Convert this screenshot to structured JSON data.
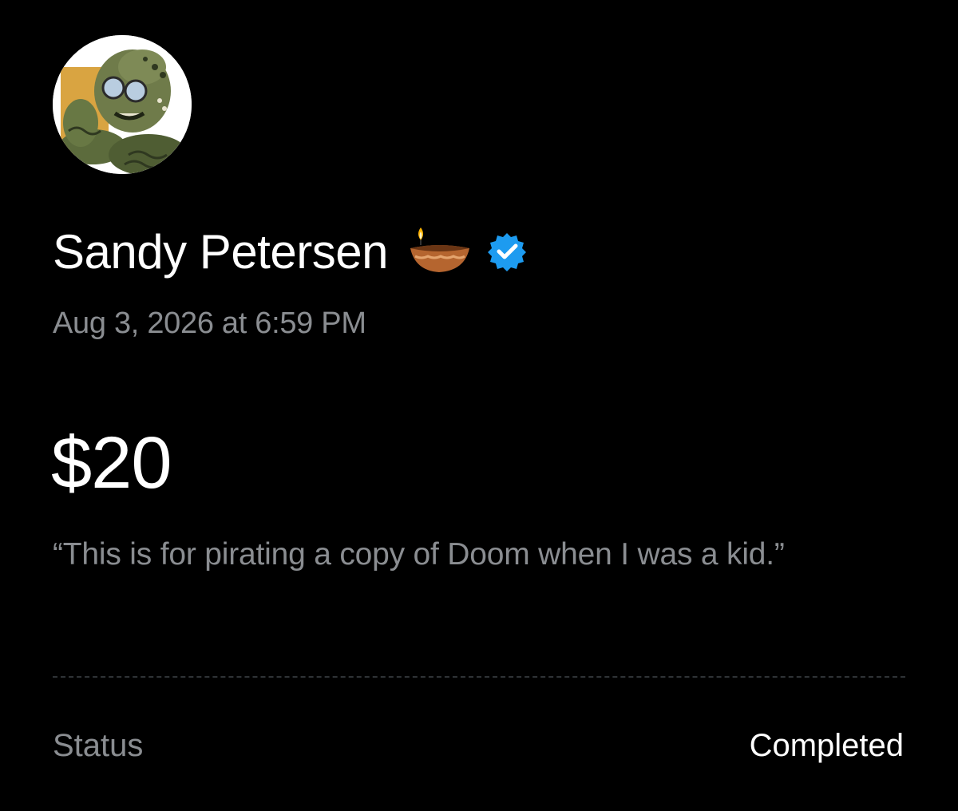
{
  "profile": {
    "avatar_icon": "avatar",
    "display_name": "Sandy Petersen",
    "emoji_icon": "diya-lamp-icon",
    "verified_icon": "verified-badge-icon",
    "verified_color": "#1d9bf0"
  },
  "transaction": {
    "timestamp": "Aug 3, 2026 at 6:59 PM",
    "amount": "$20",
    "message": "“This is for pirating a copy of Doom when I was a kid.”"
  },
  "details": {
    "status_label": "Status",
    "status_value": "Completed"
  },
  "colors": {
    "background": "#000000",
    "primary_text": "#ffffff",
    "secondary_text": "#8a8d91",
    "divider": "#2f3336"
  }
}
